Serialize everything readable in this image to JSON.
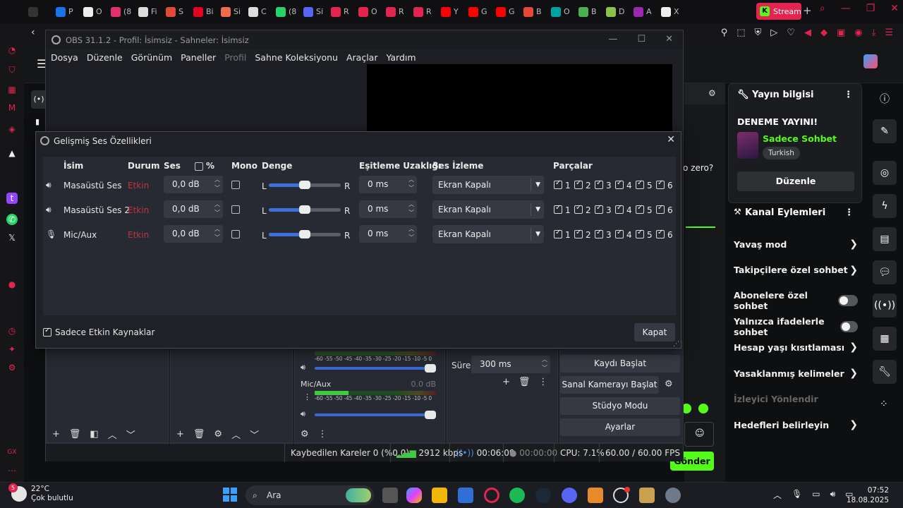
{
  "browser": {
    "tabs": [
      {
        "label": "",
        "color": "#333"
      },
      {
        "label": "P",
        "color": "#1a73e8"
      },
      {
        "label": "O",
        "color": "#eee"
      },
      {
        "label": "(8",
        "color": "#e1306c"
      },
      {
        "label": "Fi",
        "color": "#ddd"
      },
      {
        "label": "S",
        "color": "#e34a35"
      },
      {
        "label": "Bi",
        "color": "#e60023"
      },
      {
        "label": "Si",
        "color": "#f06b4b"
      },
      {
        "label": "C",
        "color": "#ddd"
      },
      {
        "label": "(8",
        "color": "#25d366"
      },
      {
        "label": "Si",
        "color": "#5865f2"
      },
      {
        "label": "R",
        "color": "#e3244f"
      },
      {
        "label": "O",
        "color": "#e3244f"
      },
      {
        "label": "R",
        "color": "#e3244f"
      },
      {
        "label": "R",
        "color": "#e3244f"
      },
      {
        "label": "Y",
        "color": "#ff0000"
      },
      {
        "label": "G",
        "color": "#ff0000"
      },
      {
        "label": "G",
        "color": "#ff0000"
      },
      {
        "label": "B",
        "color": "#e34a35"
      },
      {
        "label": "O",
        "color": "#00a3a3"
      },
      {
        "label": "B",
        "color": "#4caf50"
      },
      {
        "label": "D",
        "color": "#8bc34a"
      },
      {
        "label": "A",
        "color": "#9c27b0"
      },
      {
        "label": "X",
        "color": "#eee"
      }
    ],
    "active_tab": "Stream",
    "new_tab": "+"
  },
  "obs": {
    "title": "OBS 31.1.2 - Profil: İsimsiz - Sahneler: İsimsiz",
    "menu": [
      "Dosya",
      "Düzenle",
      "Görünüm",
      "Paneller",
      "Profil",
      "Sahne Koleksiyonu",
      "Araçlar",
      "Yardım"
    ],
    "mixer": {
      "mic_label": "Mic/Aux",
      "mic_db": "0.0 dB",
      "scale": "-60 -55 -50 -45 -40 -35 -30 -25 -20 -15 -10 -5 0"
    },
    "transition": {
      "label": "Süre",
      "value": "300 ms"
    },
    "controls": [
      "Kaydı Başlat",
      "Sanal Kamerayı Başlat",
      "Stüdyo Modu",
      "Ayarlar"
    ],
    "status": {
      "dropped": "Kaybedilen Kareler 0 (%0.0)",
      "bitrate": "2912 kbps",
      "stream_time": "00:06:09",
      "rec_time": "00:00:00",
      "cpu": "CPU: 7.1%",
      "fps": "60.00 / 60.00 FPS"
    }
  },
  "dialog": {
    "title": "Gelişmiş Ses Özellikleri",
    "headers": {
      "name": "İsim",
      "status": "Durum",
      "volume": "Ses",
      "percent": "%",
      "mono": "Mono",
      "balance": "Denge",
      "sync": "Eşitleme Uzaklığı",
      "monitor": "Ses İzleme",
      "tracks": "Parçalar"
    },
    "balance_left": "L",
    "balance_right": "R",
    "rows": [
      {
        "name": "Masaüstü Ses",
        "status": "Etkin",
        "volume": "0,0 dB",
        "mono": false,
        "balance": 0.5,
        "sync": "0 ms",
        "monitor": "Ekran Kapalı",
        "icon": "speaker-icon"
      },
      {
        "name": "Masaüstü Ses 2",
        "status": "Etkin",
        "volume": "0,0 dB",
        "mono": false,
        "balance": 0.5,
        "sync": "0 ms",
        "monitor": "Ekran Kapalı",
        "icon": "speaker-icon"
      },
      {
        "name": "Mic/Aux",
        "status": "Etkin",
        "volume": "0,0 dB",
        "mono": false,
        "balance": 0.5,
        "sync": "0 ms",
        "monitor": "Ekran Kapalı",
        "icon": "microphone-icon"
      }
    ],
    "track_numbers": [
      "1",
      "2",
      "3",
      "4",
      "5",
      "6"
    ],
    "active_only_label": "Sadece Etkin Kaynaklar",
    "close_label": "Kapat"
  },
  "kick": {
    "chat_snippet": "o zero?",
    "stream_info": {
      "header": "Yayın bilgisi",
      "title": "DENEME YAYINI!",
      "category": "Sadece Sohbet",
      "language": "Turkish",
      "edit": "Düzenle"
    },
    "channel_actions": {
      "header": "Kanal Eylemleri",
      "items": [
        {
          "label": "Yavaş mod",
          "kind": "chevron"
        },
        {
          "label": "Takipçilere özel sohbet",
          "kind": "chevron"
        },
        {
          "label": "Abonelere özel sohbet",
          "kind": "toggle"
        },
        {
          "label": "Yalnızca ifadelerle sohbet",
          "kind": "toggle"
        },
        {
          "label": "Hesap yaşı kısıtlaması",
          "kind": "chevron"
        },
        {
          "label": "Yasaklanmış kelimeler",
          "kind": "chevron"
        },
        {
          "label": "İzleyici Yönlendir",
          "kind": "disabled"
        },
        {
          "label": "Hedefleri belirleyin",
          "kind": "chevron"
        }
      ]
    },
    "send": "Gönder",
    "accent": "#53fc18"
  },
  "taskbar": {
    "temperature": "22°C",
    "condition": "Çok bulutlu",
    "badge": "5",
    "search_placeholder": "Ara",
    "time": "07:52",
    "date": "18.08.2025"
  }
}
